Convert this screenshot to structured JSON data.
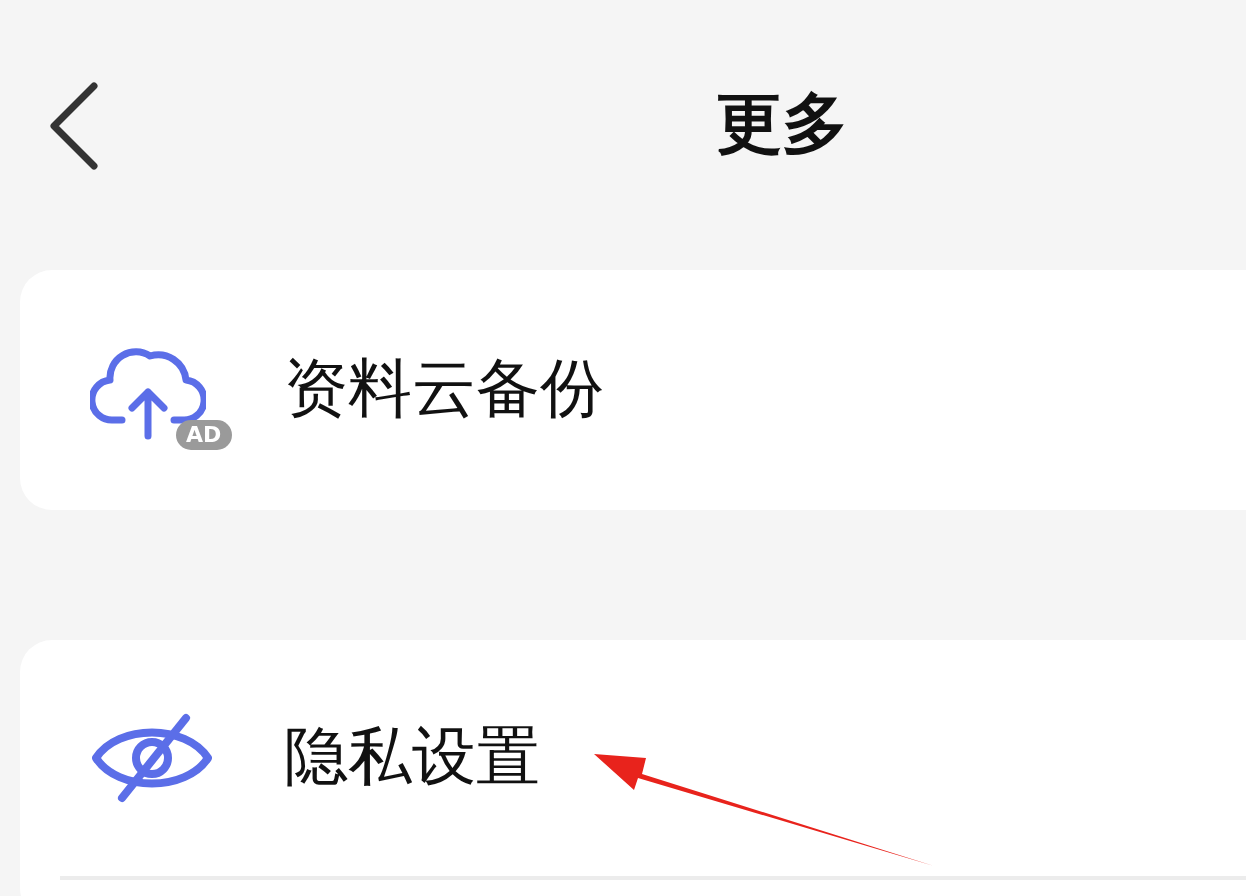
{
  "header": {
    "title": "更多"
  },
  "sections": [
    {
      "items": [
        {
          "kind": "cloud-upload",
          "label": "资料云备份",
          "badge": "AD"
        }
      ]
    },
    {
      "items": [
        {
          "kind": "privacy",
          "label": "隐私设置"
        }
      ]
    }
  ]
}
